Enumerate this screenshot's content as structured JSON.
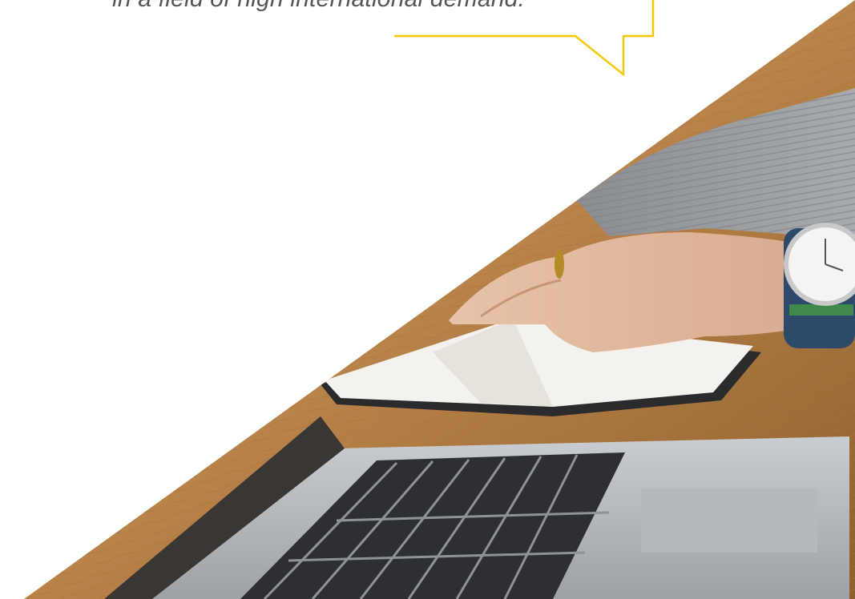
{
  "quote": {
    "line": "in a field of high international demand."
  },
  "colors": {
    "accent_yellow": "#f5c800",
    "text_gray": "#555555",
    "background": "#ffffff"
  },
  "photo": {
    "subject": "hands writing in notebook beside laptop on wooden desk, wristwatch"
  }
}
